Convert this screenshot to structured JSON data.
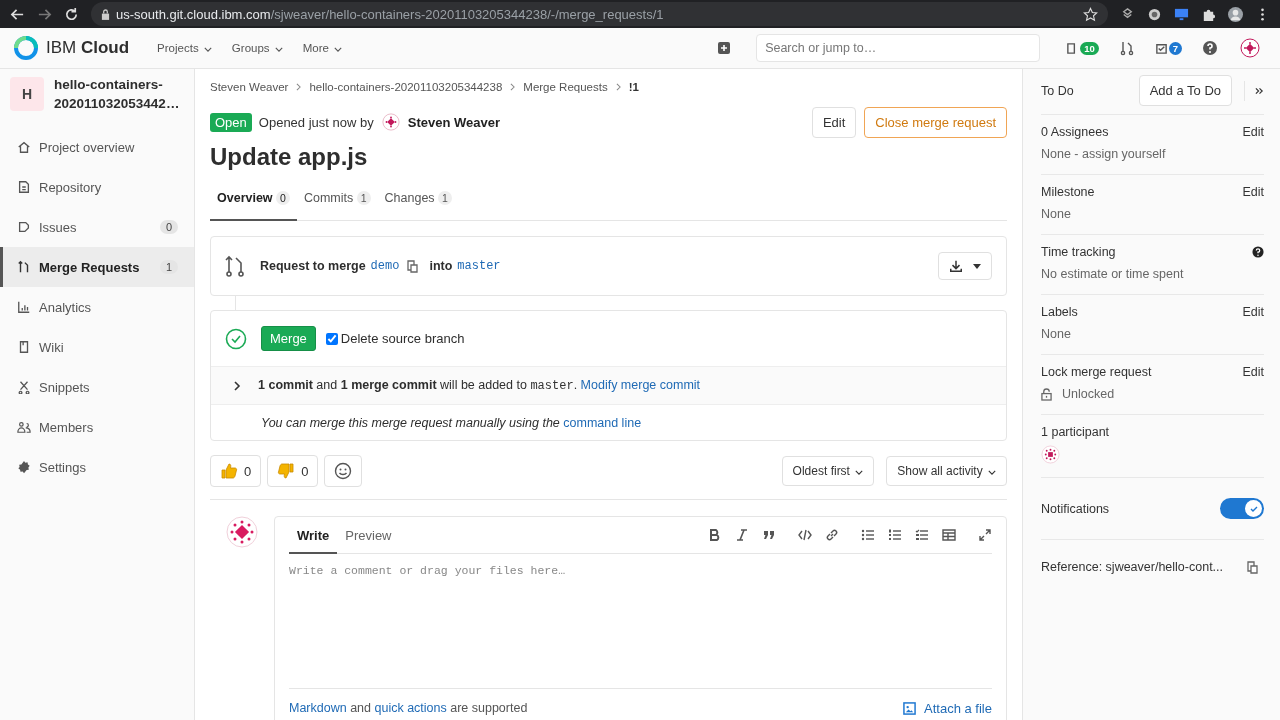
{
  "browser": {
    "url_host": "us-south.git.cloud.ibm.com",
    "url_path": "/sjweaver/hello-containers-20201103205344238/-/merge_requests/1"
  },
  "topbar": {
    "logo": "IBM **Cloud**",
    "nav": [
      "Projects",
      "Groups",
      "More"
    ],
    "search_placeholder": "Search or jump to…",
    "issues_count": "10",
    "todos_count": "7"
  },
  "sidebar": {
    "project_initial": "H",
    "project_name": "hello-containers-202011032053442…",
    "items": [
      {
        "label": "Project overview",
        "selected": false
      },
      {
        "label": "Repository",
        "selected": false
      },
      {
        "label": "Issues",
        "count": "0",
        "selected": false
      },
      {
        "label": "Merge Requests",
        "count": "1",
        "selected": true
      },
      {
        "label": "Analytics",
        "selected": false
      },
      {
        "label": "Wiki",
        "selected": false
      },
      {
        "label": "Snippets",
        "selected": false
      },
      {
        "label": "Members",
        "selected": false
      },
      {
        "label": "Settings",
        "selected": false
      }
    ]
  },
  "breadcrumbs": [
    "Steven Weaver",
    "hello-containers-20201103205344238",
    "Merge Requests",
    "!1"
  ],
  "header": {
    "status": "Open",
    "opened_text": "Opened just now by",
    "author": "Steven Weaver",
    "buttons": [
      "Edit",
      "Close merge request"
    ],
    "title": "Update app.js"
  },
  "tabs": [
    {
      "label": "Overview",
      "count": "0",
      "selected": true
    },
    {
      "label": "Commits",
      "count": "1",
      "selected": false
    },
    {
      "label": "Changes",
      "count": "1",
      "selected": false
    }
  ],
  "widget": {
    "request_text": "Request to merge",
    "source": "demo",
    "into_text": "into",
    "target": "master",
    "merge_button": "Merge",
    "delete_source": {
      "label": "Delete source branch",
      "checked": true
    },
    "commit_summary": "**1 commit** and **1 merge commit** will be added to",
    "commit_branch": "master",
    "commit_end": ".",
    "modify_link": "Modify merge commit",
    "manual_text": "You can merge this merge request manually using the",
    "manual_link": "command line"
  },
  "reactions": [
    {
      "count": "0"
    },
    {
      "count": "0"
    }
  ],
  "sort": "Oldest first",
  "filter": "Show all activity",
  "comment": {
    "tabs": [
      {
        "label": "Write",
        "selected": true
      },
      {
        "label": "Preview",
        "selected": false
      }
    ],
    "placeholder": "Write a comment or drag your files here…",
    "markdown_link": "Markdown",
    "and_text": "and",
    "quick_link": "quick actions",
    "supported_text": "are supported",
    "attach": "Attach a file"
  },
  "right": {
    "todo_label": "To Do",
    "todo_button": "Add a To Do",
    "sections": [
      {
        "kind": "edit",
        "title": "0 Assignees",
        "action": "Edit",
        "value": "None - assign yourself"
      },
      {
        "kind": "edit",
        "title": "Milestone",
        "action": "Edit",
        "value": "None"
      },
      {
        "kind": "help",
        "title": "Time tracking",
        "value": "No estimate or time spent"
      },
      {
        "kind": "edit",
        "title": "Labels",
        "action": "Edit",
        "value": "None"
      },
      {
        "kind": "lock",
        "title": "Lock merge request",
        "action": "Edit",
        "value": "Unlocked"
      }
    ],
    "participants": "1 participant",
    "notifications": {
      "label": "Notifications",
      "on": true
    },
    "reference": "Reference: sjweaver/hello-cont..."
  }
}
